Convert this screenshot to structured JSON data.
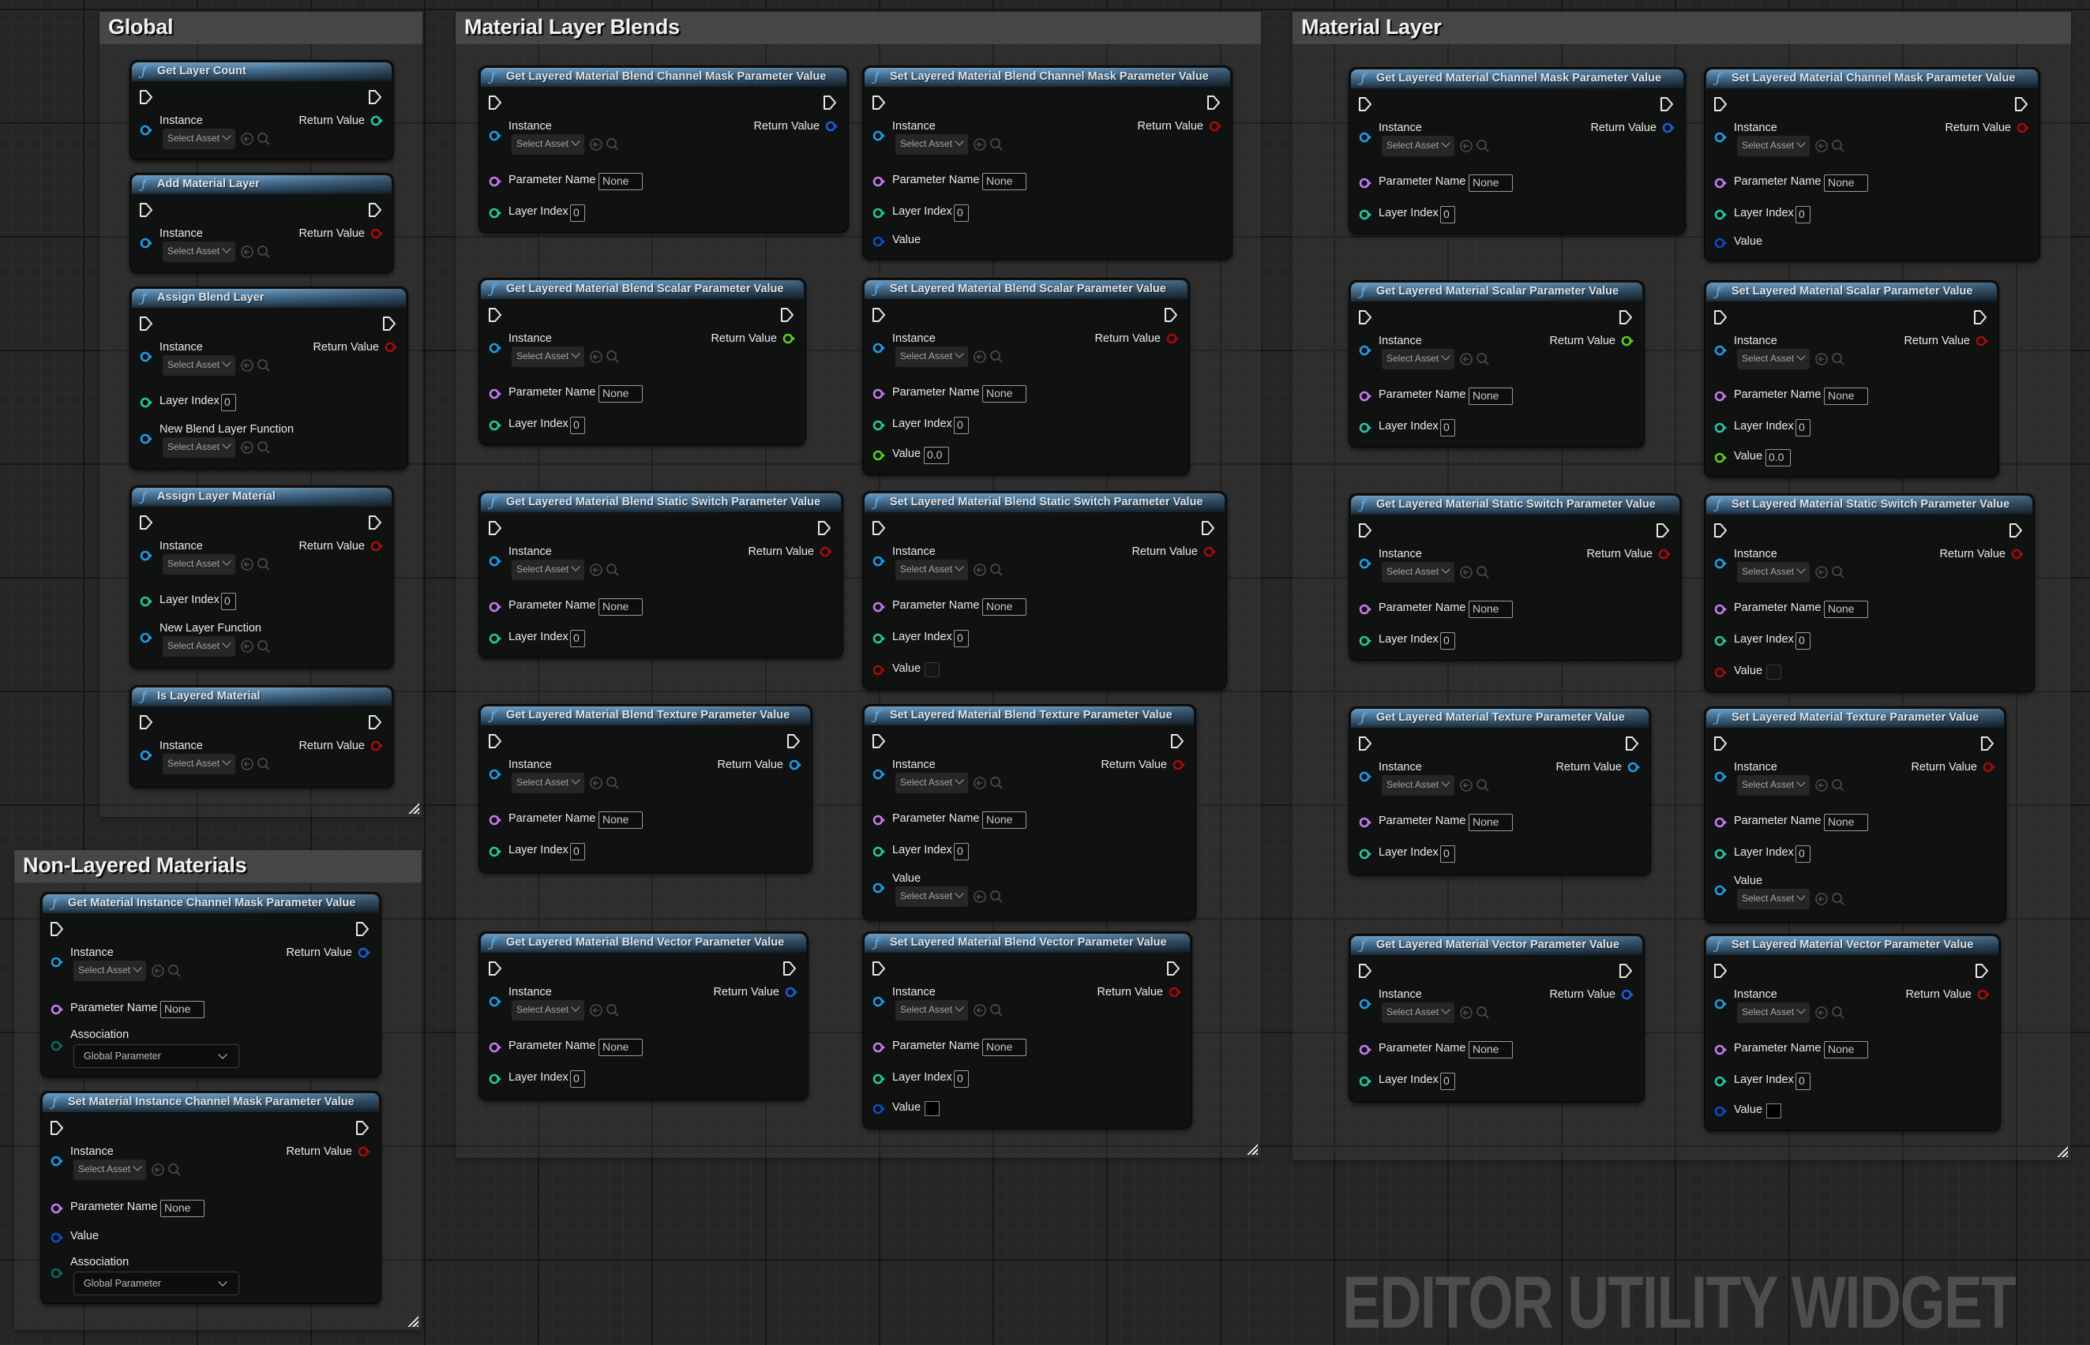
{
  "watermark": "EDITOR UTILITY WIDGET",
  "pin_colors": {
    "object": "#1f9be6",
    "object_out": "#1a5fd6",
    "name": "#c57bf0",
    "int": "#23c9a3",
    "float": "#57d11c",
    "bool": "#a80b0b",
    "enum": "#0c6b5c",
    "struct": "#0a4fc2",
    "exec": "#e6e6e6"
  },
  "common": {
    "instance_label": "Instance",
    "return_label": "Return Value",
    "select_asset": "Select Asset",
    "parameter_name_label": "Parameter Name",
    "layer_index_label": "Layer Index",
    "value_label": "Value",
    "association_label": "Association",
    "none_value": "None",
    "zero_value": "0",
    "float_zero": "0.0",
    "global_parameter": "Global Parameter"
  },
  "groups": {
    "global": {
      "title": "Global"
    },
    "non_layered": {
      "title": "Non-Layered Materials"
    },
    "blends": {
      "title": "Material Layer Blends"
    },
    "layer": {
      "title": "Material Layer"
    }
  },
  "nodes": {
    "get_layer_count": {
      "title": "Get Layer Count",
      "return_type": "int"
    },
    "add_material_layer": {
      "title": "Add Material Layer",
      "return_type": "bool"
    },
    "assign_blend_layer": {
      "title": "Assign Blend Layer",
      "return_type": "bool",
      "layer_index": "0",
      "extra_label": "New Blend Layer Function"
    },
    "assign_layer_material": {
      "title": "Assign Layer Material",
      "return_type": "bool",
      "layer_index": "0",
      "extra_label": "New Layer Function"
    },
    "is_layered_material": {
      "title": "Is Layered Material",
      "return_type": "bool"
    },
    "get_mi_channel_mask": {
      "title": "Get Material Instance Channel Mask Parameter Value",
      "parameter_name": "None",
      "association": "Global Parameter"
    },
    "set_mi_channel_mask": {
      "title": "Set Material Instance Channel Mask Parameter Value",
      "parameter_name": "None",
      "association": "Global Parameter"
    },
    "get_blend_channel_mask": {
      "title": "Get Layered Material Blend Channel Mask Parameter Value",
      "parameter_name": "None",
      "layer_index": "0"
    },
    "set_blend_channel_mask": {
      "title": "Set Layered Material Blend Channel Mask Parameter Value",
      "parameter_name": "None",
      "layer_index": "0"
    },
    "get_blend_scalar": {
      "title": "Get Layered Material Blend Scalar Parameter Value",
      "parameter_name": "None",
      "layer_index": "0"
    },
    "set_blend_scalar": {
      "title": "Set Layered Material Blend Scalar Parameter Value",
      "parameter_name": "None",
      "layer_index": "0",
      "value": "0.0"
    },
    "get_blend_static_switch": {
      "title": "Get Layered Material Blend Static Switch Parameter Value",
      "parameter_name": "None",
      "layer_index": "0"
    },
    "set_blend_static_switch": {
      "title": "Set Layered Material Blend Static Switch Parameter Value",
      "parameter_name": "None",
      "layer_index": "0",
      "value_checked": false
    },
    "get_blend_texture": {
      "title": "Get Layered Material Blend Texture Parameter Value",
      "parameter_name": "None",
      "layer_index": "0"
    },
    "set_blend_texture": {
      "title": "Set Layered Material Blend Texture Parameter Value",
      "parameter_name": "None",
      "layer_index": "0",
      "value": "Select Asset"
    },
    "get_blend_vector": {
      "title": "Get Layered Material Blend Vector Parameter Value",
      "parameter_name": "None",
      "layer_index": "0"
    },
    "set_blend_vector": {
      "title": "Set Layered Material Blend Vector Parameter Value",
      "parameter_name": "None",
      "layer_index": "0",
      "value_color": "#000000"
    },
    "get_layer_channel_mask": {
      "title": "Get Layered Material Channel Mask Parameter Value",
      "parameter_name": "None",
      "layer_index": "0"
    },
    "set_layer_channel_mask": {
      "title": "Set Layered Material Channel Mask Parameter Value",
      "parameter_name": "None",
      "layer_index": "0"
    },
    "get_layer_scalar": {
      "title": "Get Layered Material Scalar Parameter Value",
      "parameter_name": "None",
      "layer_index": "0"
    },
    "set_layer_scalar": {
      "title": "Set Layered Material Scalar Parameter Value",
      "parameter_name": "None",
      "layer_index": "0",
      "value": "0.0"
    },
    "get_layer_static_switch": {
      "title": "Get Layered Material Static Switch Parameter Value",
      "parameter_name": "None",
      "layer_index": "0"
    },
    "set_layer_static_switch": {
      "title": "Set Layered Material Static Switch Parameter Value",
      "parameter_name": "None",
      "layer_index": "0",
      "value_checked": false
    },
    "get_layer_texture": {
      "title": "Get Layered Material Texture Parameter Value",
      "parameter_name": "None",
      "layer_index": "0"
    },
    "set_layer_texture": {
      "title": "Set Layered Material Texture Parameter Value",
      "parameter_name": "None",
      "layer_index": "0",
      "value": "Select Asset"
    },
    "get_layer_vector": {
      "title": "Get Layered Material Vector Parameter Value",
      "parameter_name": "None",
      "layer_index": "0"
    },
    "set_layer_vector": {
      "title": "Set Layered Material Vector Parameter Value",
      "parameter_name": "None",
      "layer_index": "0",
      "value_color": "#000000"
    }
  }
}
